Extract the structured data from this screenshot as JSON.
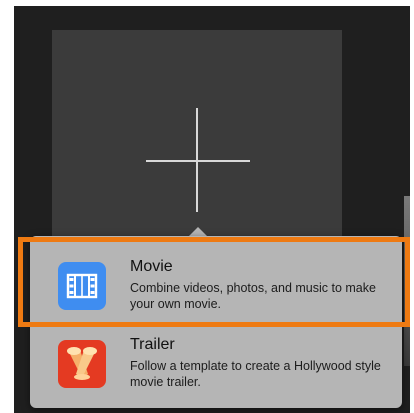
{
  "new_project_popover": {
    "options": [
      {
        "title": "Movie",
        "description": "Combine videos, photos, and music to make your own movie.",
        "icon": "film-strip-icon"
      },
      {
        "title": "Trailer",
        "description": "Follow a template to create a Hollywood style movie trailer.",
        "icon": "spotlights-icon"
      }
    ]
  },
  "colors": {
    "highlight": "#ee7a12",
    "movie_icon": "#3f8df0",
    "trailer_icon": "#e43a22",
    "popover_bg": "#b5b5b5",
    "tile_bg": "#3b3b3b"
  }
}
